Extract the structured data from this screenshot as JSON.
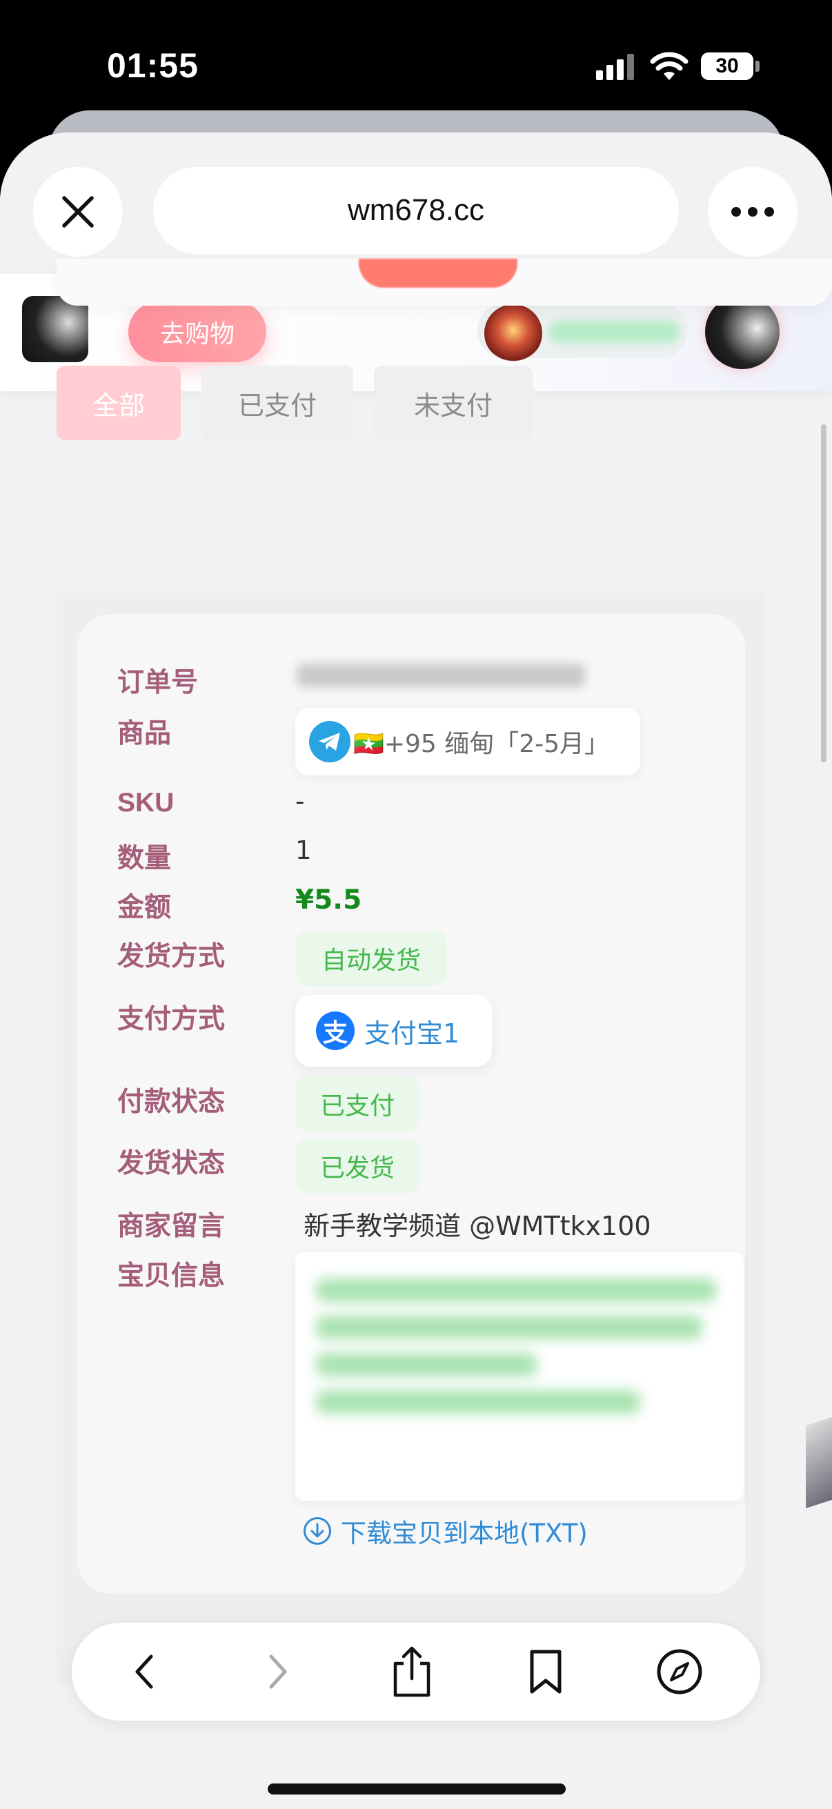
{
  "status_bar": {
    "time": "01:55",
    "battery": "30"
  },
  "browser": {
    "url": "wm678.cc"
  },
  "header": {
    "shop_button": "去购物"
  },
  "tabs": [
    {
      "label": "全部",
      "active": true
    },
    {
      "label": "已支付",
      "active": false
    },
    {
      "label": "未支付",
      "active": false
    }
  ],
  "order": {
    "labels": {
      "order_no": "订单号",
      "product": "商品",
      "sku": "SKU",
      "quantity": "数量",
      "amount": "金额",
      "delivery_method": "发货方式",
      "payment_method": "支付方式",
      "payment_status": "付款状态",
      "delivery_status": "发货状态",
      "merchant_note": "商家留言",
      "item_info": "宝贝信息"
    },
    "product": "🇲🇲+95 缅甸「2-5月」",
    "sku": "-",
    "quantity": "1",
    "amount": "¥5.5",
    "delivery_method": "自动发货",
    "payment_method": "支付宝1",
    "payment_status": "已支付",
    "delivery_status": "已发货",
    "merchant_note": "新手教学频道 @WMTtkx100",
    "download_link": "下载宝贝到本地(TXT)"
  },
  "colors": {
    "label": "#a45e7a",
    "amount": "#138a1c",
    "status_chip_bg": "#e9f8ea",
    "status_chip_text": "#45b84d",
    "link": "#2f8bd6",
    "shop_button": "#ff8f9c"
  },
  "icons": [
    "close-icon",
    "more-icon",
    "telegram-icon",
    "myanmar-flag-icon",
    "alipay-icon",
    "download-icon",
    "back-icon",
    "forward-icon",
    "share-icon",
    "bookmark-icon",
    "compass-icon"
  ]
}
